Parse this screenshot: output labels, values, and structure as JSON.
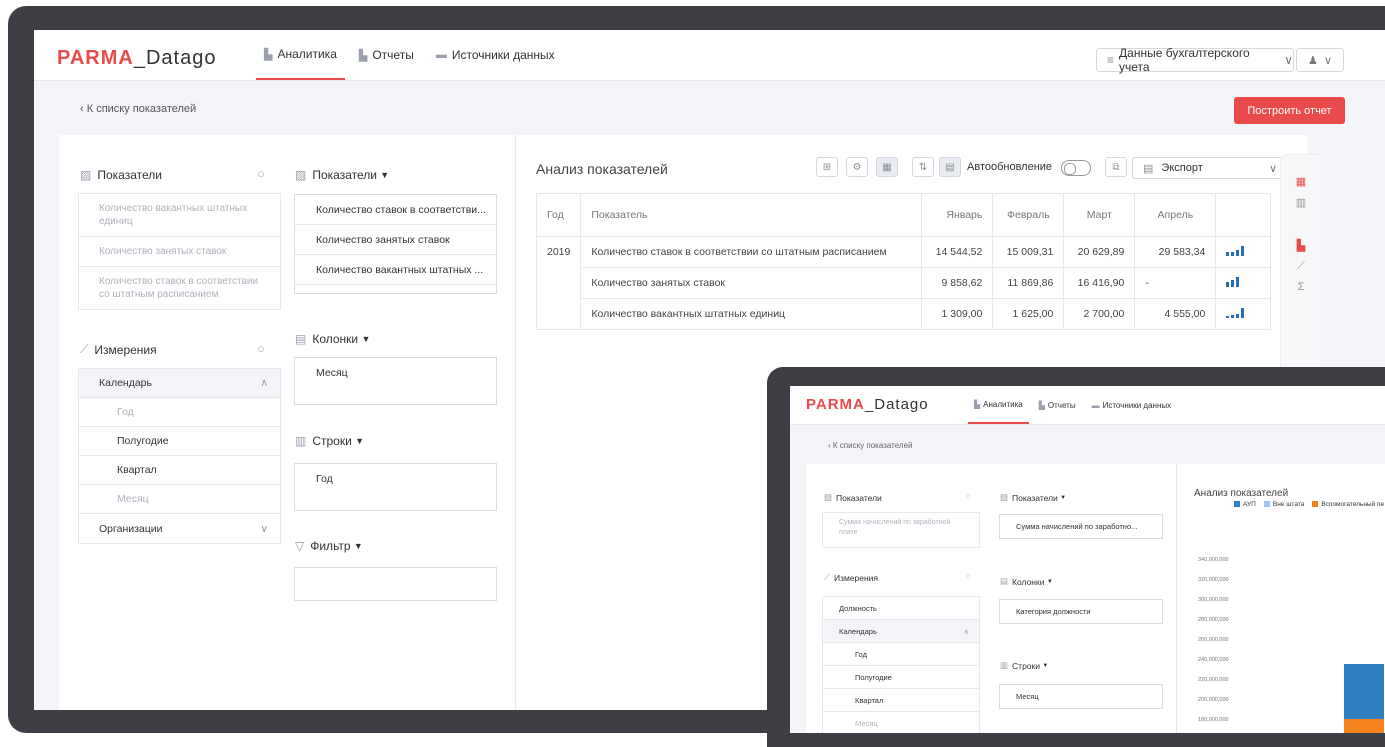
{
  "logo": {
    "part1": "PARMA",
    "part2": "_Datago"
  },
  "nav": [
    {
      "icon": "chart-icon",
      "label": "Аналитика"
    },
    {
      "icon": "report-icon",
      "label": "Отчеты"
    },
    {
      "icon": "folder-icon",
      "label": "Источники данных"
    }
  ],
  "header": {
    "data_source": "Данные бухгалтерского учета"
  },
  "back_link": "К списку показателей",
  "build_button": "Построить отчет",
  "left": {
    "indicators_title": "Показатели",
    "indicators": [
      "Количество вакантных штатных единиц",
      "Количество занятых ставок",
      "Количество ставок в соответствии со штатным расписанием"
    ],
    "dimensions_title": "Измерения",
    "dimensions": [
      {
        "label": "Календарь",
        "state": "expanded"
      },
      {
        "label": "Год",
        "muted": true
      },
      {
        "label": "Полугодие",
        "muted": false
      },
      {
        "label": "Квартал",
        "muted": false
      },
      {
        "label": "Месяц",
        "muted": true
      },
      {
        "label": "Организации",
        "state": "collapsed"
      }
    ]
  },
  "middle": {
    "indicators_title": "Показатели",
    "indicators": [
      "Количество ставок в соответстви...",
      "Количество занятых ставок",
      "Количество вакантных штатных ..."
    ],
    "columns_title": "Колонки",
    "columns_value": "Месяц",
    "rows_title": "Строки",
    "rows_value": "Год",
    "filter_title": "Фильтр"
  },
  "analysis": {
    "title": "Анализ показателей",
    "auto_update_label": "Автообновление",
    "export_label": "Экспорт",
    "table": {
      "headers": [
        "Год",
        "Показатель",
        "Январь",
        "Февраль",
        "Март",
        "Апрель"
      ],
      "year": "2019",
      "rows": [
        {
          "name": "Количество ставок в соответствии со штатным расписанием",
          "values": [
            "14 544,52",
            "15 009,31",
            "20 629,89",
            "29 583,34"
          ]
        },
        {
          "name": "Количество занятых ставок",
          "values": [
            "9 858,62",
            "11 869,86",
            "16 416,90",
            "-"
          ]
        },
        {
          "name": "Количество вакантных штатных единиц",
          "values": [
            "1 309,00",
            "1 625,00",
            "2 700,00",
            "4 555,00"
          ]
        }
      ]
    }
  },
  "second_screen": {
    "nav": [
      "Аналитика",
      "Отчеты",
      "Источники данных"
    ],
    "back_link": "К списку показателей",
    "indicators_title": "Показатели",
    "indicator_item": "Сумма начислений по заработной плате",
    "selected_indicator": "Сумма начислений по заработно...",
    "dimensions_title": "Измерения",
    "dimensions": [
      "Должность",
      "Календарь",
      "Год",
      "Полугодие",
      "Квартал",
      "Месяц"
    ],
    "columns_title": "Колонки",
    "columns_value": "Категория должности",
    "rows_title": "Строки",
    "rows_value": "Месяц",
    "chart_title": "Анализ показателей",
    "legend": [
      {
        "name": "АУП",
        "color": "#2f7ec1"
      },
      {
        "name": "Вне штата",
        "color": "#9ec6e8"
      },
      {
        "name": "Вспомогательный пе",
        "color": "#f5821f"
      }
    ],
    "y_ticks": [
      "340,000,000",
      "320,000,000",
      "300,000,000",
      "280,000,000",
      "260,000,000",
      "240,000,000",
      "220,000,000",
      "200,000,000",
      "180,000,000"
    ]
  }
}
